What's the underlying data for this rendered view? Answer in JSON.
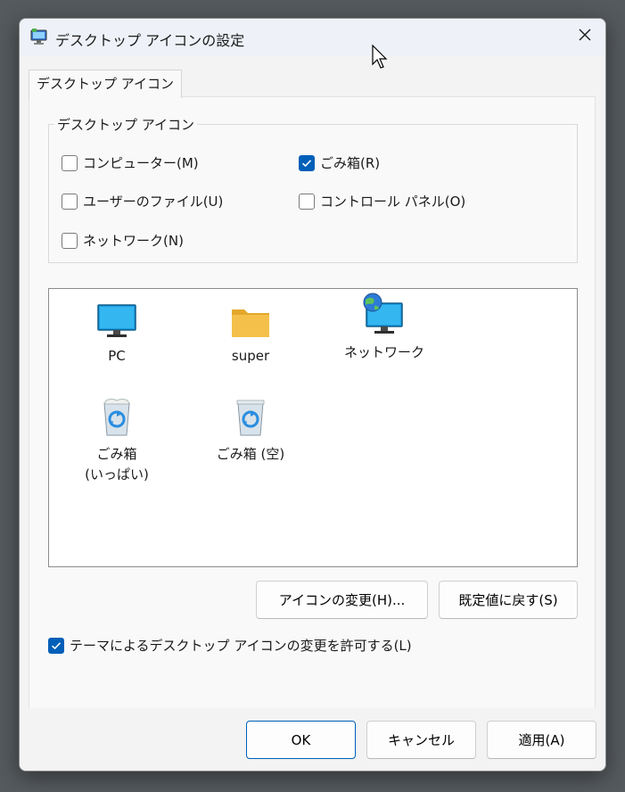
{
  "window": {
    "title": "デスクトップ アイコンの設定",
    "icons": {
      "app": "desktop-settings-icon",
      "close": "close-icon"
    }
  },
  "tab": {
    "label": "デスクトップ アイコン"
  },
  "group": {
    "legend": "デスクトップ アイコン",
    "checkboxes": [
      {
        "label": "コンピューター(M)",
        "checked": false
      },
      {
        "label": "ごみ箱(R)",
        "checked": true
      },
      {
        "label": "ユーザーのファイル(U)",
        "checked": false
      },
      {
        "label": "コントロール パネル(O)",
        "checked": false
      },
      {
        "label": "ネットワーク(N)",
        "checked": false
      }
    ]
  },
  "icon_list": [
    {
      "label": "PC",
      "icon": "monitor-icon"
    },
    {
      "label": "super",
      "icon": "folder-icon"
    },
    {
      "label": "ネットワーク",
      "icon": "network-globe-icon"
    },
    {
      "label": "ごみ箱\n(いっぱい)",
      "icon": "recycle-bin-full-icon"
    },
    {
      "label": "ごみ箱 (空)",
      "icon": "recycle-bin-empty-icon"
    }
  ],
  "buttons": {
    "change_icon": "アイコンの変更(H)...",
    "restore_default": "既定値に戻す(S)",
    "ok": "OK",
    "cancel": "キャンセル",
    "apply": "適用(A)"
  },
  "theme_option": {
    "label": "テーマによるデスクトップ アイコンの変更を許可する(L)",
    "checked": true
  },
  "colors": {
    "accent": "#005fb8",
    "titlebar": "#eef2f8",
    "folder": "#f5c04a",
    "monitor": "#1e9fe0"
  }
}
